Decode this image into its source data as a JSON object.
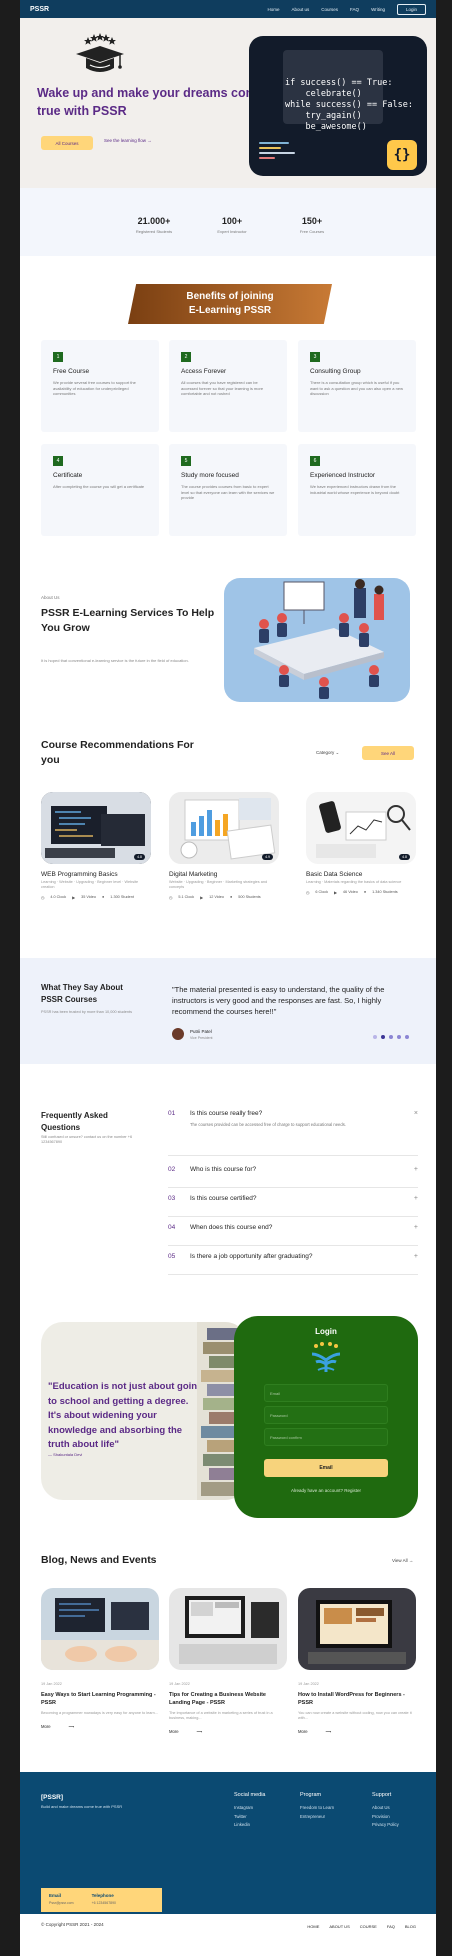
{
  "nav": {
    "brand": "PSSR",
    "links": [
      "Home",
      "About us",
      "Courses",
      "FAQ",
      "Writing"
    ],
    "login": "Login"
  },
  "hero": {
    "headline": "Wake up and make your dreams come true with PSSR",
    "courses_button": "All Courses",
    "learning_link": "See the learning flow →",
    "code_lines": [
      "if success() == True:",
      "    celebrate()",
      "while success() == False:",
      "    try_again()",
      "    be_awesome()"
    ],
    "code_badge": "{}"
  },
  "stats": [
    {
      "value": "21.000+",
      "label": "Registered Students"
    },
    {
      "value": "100+",
      "label": "Expert Instructor"
    },
    {
      "value": "150+",
      "label": "Free Courses"
    }
  ],
  "benefits": {
    "title_line1": "Benefits of joining",
    "title_line2": "E-Learning PSSR",
    "items": [
      {
        "num": "1",
        "title": "Free Course",
        "desc": "We provide several free courses to support the availability of education for underprivileged communities"
      },
      {
        "num": "2",
        "title": "Access Forever",
        "desc": "All courses that you have registered can be accessed forever so that your learning is more comfortable and not rushed"
      },
      {
        "num": "3",
        "title": "Consulting Group",
        "desc": "There is a consultation group which is useful if you want to ask a question and you can also open a new discussion"
      },
      {
        "num": "4",
        "title": "Certificate",
        "desc": "After completing the course you will get a certificate"
      },
      {
        "num": "5",
        "title": "Study more focused",
        "desc": "The course provides courses from basic to expert level so that everyone can learn with the services we provide"
      },
      {
        "num": "6",
        "title": "Experienced Instructor",
        "desc": "We have experienced instructors drawn from the industrial world whose experience is beyond doubt"
      }
    ]
  },
  "about": {
    "label": "About Us",
    "title": "PSSR E-Learning Services To Help You Grow",
    "desc": "It is hoped that conventional e-learning service is the future in the field of education."
  },
  "courses": {
    "title": "Course Recommendations For you",
    "category": "Category ⌄",
    "see_all": "See All",
    "items": [
      {
        "title": "WEB Programming Basics",
        "tags": "Learning · Website · Upgrading · Beginner level · Website creation",
        "clock": "4.0 Clock",
        "videos": "35 Video",
        "students": "1.300 Student",
        "badge": "4.8"
      },
      {
        "title": "Digital Marketing",
        "tags": "Website · Upgrading · Beginner · Marketing strategies and concepts",
        "clock": "5.1 Clock",
        "videos": "12 Video",
        "students": "500 Students",
        "badge": "4.9"
      },
      {
        "title": "Basic Data Science",
        "tags": "Learning · Materials regarding the basics of data science",
        "clock": "6 Clock",
        "videos": "46 Video",
        "students": "1.340 Students",
        "badge": "4.8"
      }
    ]
  },
  "testimonials": {
    "title": "What They Say About PSSR Courses",
    "sub": "PSSR has been trusted by more than 10,000 students",
    "quote": "\"The material presented is easy to understand, the quality of the instructors is very good and the responses are fast. So, I highly recommend the courses here!!\"",
    "name": "Putrii Patel",
    "role": "Vice President"
  },
  "faq": {
    "title": "Frequently Asked Questions",
    "sub": "Still confused or unsure? contact us on the number +6 1234567890",
    "items": [
      {
        "num": "01",
        "q": "Is this course really free?",
        "a": "The courses provided can be accessed free of charge to support educational needs.",
        "icon": "×"
      },
      {
        "num": "02",
        "q": "Who is this course for?",
        "icon": "+"
      },
      {
        "num": "03",
        "q": "Is this course certified?",
        "icon": "+"
      },
      {
        "num": "04",
        "q": "When does this course end?",
        "icon": "+"
      },
      {
        "num": "05",
        "q": "Is there a job opportunity after graduating?",
        "icon": "+"
      }
    ]
  },
  "quote_panel": {
    "text": "\"Education is not just about going to school and getting a degree. It's about widening your knowledge and absorbing the truth about life\"",
    "author": "— Shakuntala Devi"
  },
  "login": {
    "title": "Login",
    "email_ph": "Email",
    "password_ph": "Password",
    "confirm_ph": "Password confirm",
    "button": "Email",
    "register": "Already have an account? Register"
  },
  "blog": {
    "title": "Blog, News and Events",
    "view_all": "View All →",
    "posts": [
      {
        "date": "19 Jan 2022",
        "title": "Easy Ways to Start Learning Programming - PSSR",
        "desc": "Becoming a programmer nowadays is very easy for anyone to learn...",
        "more": "More",
        "arrow": "⟶"
      },
      {
        "date": "19 Jan 2022",
        "title": "Tips for Creating a Business Website Landing Page - PSSR",
        "desc": "The importance of a website in marketing a series of trust in a business, making...",
        "more": "More",
        "arrow": "⟶"
      },
      {
        "date": "19 Jan 2022",
        "title": "How to Install WordPress for Beginners - PSSR",
        "desc": "You can now create a website without coding, now you can create it with...",
        "more": "More",
        "arrow": "⟶"
      }
    ]
  },
  "footer": {
    "brand": "[PSSR]",
    "desc": "Build and make dreams come true with PSSR",
    "columns": [
      {
        "heading": "Social media",
        "links": [
          "Instagram",
          "Twitter",
          "Linkedin"
        ]
      },
      {
        "heading": "Program",
        "links": [
          "Freedom to Learn",
          "Entrepreneur"
        ]
      },
      {
        "heading": "Support",
        "links": [
          "About Us",
          "Provision",
          "Privacy Policy"
        ]
      }
    ],
    "email_label": "Email",
    "email_value": "Pssr@pssr.com",
    "phone_label": "Telephone",
    "phone_value": "+6 1234567890",
    "copyright": "© Copyright PSSR 2021 - 2024",
    "bottom_links": [
      "HOME",
      "ABOUT US",
      "COURSE",
      "FAQ",
      "BLOG"
    ]
  }
}
